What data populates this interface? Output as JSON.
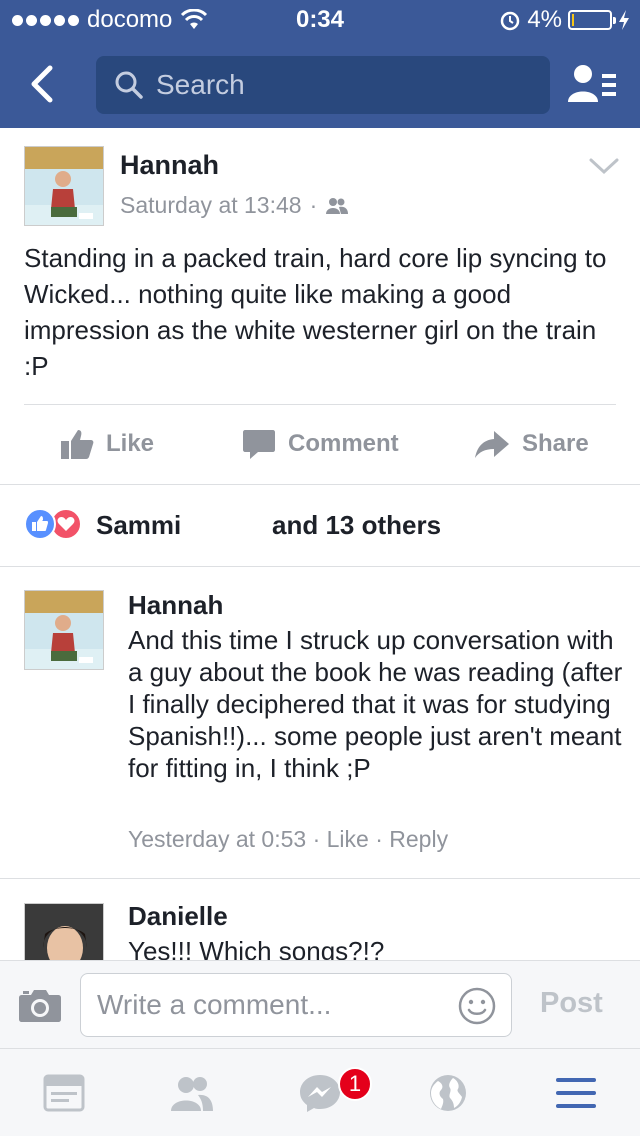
{
  "status_bar": {
    "carrier": "docomo",
    "time": "0:34",
    "battery": "4%",
    "battery_level": 0.04
  },
  "nav": {
    "search_placeholder": "Search"
  },
  "post": {
    "author": "Hannah",
    "timestamp": "Saturday at 13:48",
    "separator": "·",
    "text": "Standing in a packed train, hard core lip syncing to Wicked... nothing quite like making a good impression as the white westerner girl on the train :P",
    "actions": {
      "like": "Like",
      "comment": "Comment",
      "share": "Share"
    },
    "reactions": {
      "name": "Sammi",
      "others": "and 13 others"
    }
  },
  "comments": [
    {
      "author": "Hannah",
      "text": "And this time I struck up conversation with a guy about the book he was reading (after I finally deciphered that it was for studying Spanish!!)... some people just aren't meant for fitting in, I think ;P",
      "time": "Yesterday at 0:53",
      "like": "Like",
      "reply": "Reply",
      "sep": "·"
    },
    {
      "author": "Danielle",
      "text": "Yes!!! Which songs?!?"
    }
  ],
  "composer": {
    "placeholder": "Write a comment...",
    "post": "Post"
  },
  "tabbar": {
    "messenger_badge": "1"
  },
  "colors": {
    "brand": "#3b5998",
    "link": "#4267b2",
    "muted": "#90949c"
  }
}
